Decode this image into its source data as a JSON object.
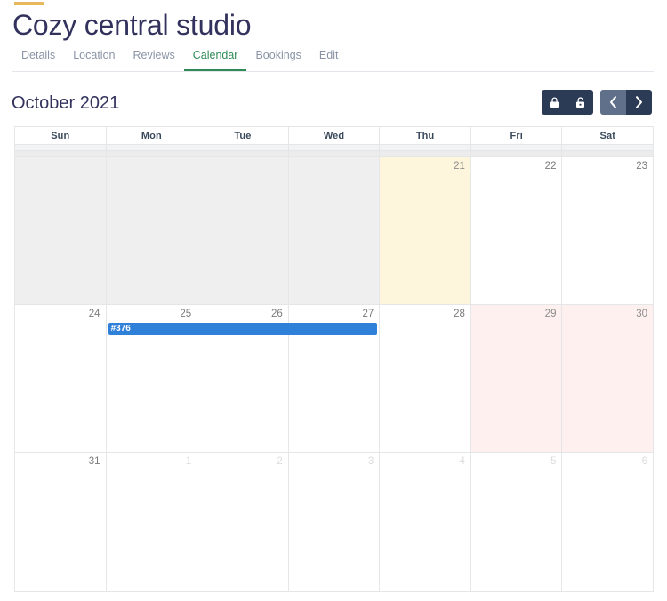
{
  "header": {
    "accent_color": "#e8b85c",
    "title": "Cozy central studio"
  },
  "tabs": [
    {
      "label": "Details",
      "active": false
    },
    {
      "label": "Location",
      "active": false
    },
    {
      "label": "Reviews",
      "active": false
    },
    {
      "label": "Calendar",
      "active": true
    },
    {
      "label": "Bookings",
      "active": false
    },
    {
      "label": "Edit",
      "active": false
    }
  ],
  "calendar": {
    "month_label": "October 2021",
    "accent_active_tab_color": "#2e8b57",
    "controls": {
      "lock_button": {
        "icon": "lock-closed-icon",
        "label": "Lock"
      },
      "unlock_button": {
        "icon": "lock-open-icon",
        "label": "Unlock"
      },
      "prev_button": {
        "icon": "chevron-left-icon",
        "label": "Previous month"
      },
      "next_button": {
        "icon": "chevron-right-icon",
        "label": "Next month"
      }
    },
    "weekday_headers": [
      "Sun",
      "Mon",
      "Tue",
      "Wed",
      "Thu",
      "Fri",
      "Sat"
    ],
    "weeks": [
      [
        {
          "num": "",
          "state": "past"
        },
        {
          "num": "",
          "state": "past"
        },
        {
          "num": "",
          "state": "past"
        },
        {
          "num": "",
          "state": "past"
        },
        {
          "num": "21",
          "state": "today"
        },
        {
          "num": "22",
          "state": "current"
        },
        {
          "num": "23",
          "state": "current"
        }
      ],
      [
        {
          "num": "24",
          "state": "current"
        },
        {
          "num": "25",
          "state": "current"
        },
        {
          "num": "26",
          "state": "current"
        },
        {
          "num": "27",
          "state": "current"
        },
        {
          "num": "28",
          "state": "current"
        },
        {
          "num": "29",
          "state": "blocked"
        },
        {
          "num": "30",
          "state": "blocked"
        }
      ],
      [
        {
          "num": "31",
          "state": "current"
        },
        {
          "num": "1",
          "state": "other"
        },
        {
          "num": "2",
          "state": "other"
        },
        {
          "num": "3",
          "state": "other"
        },
        {
          "num": "4",
          "state": "other"
        },
        {
          "num": "5",
          "state": "other"
        },
        {
          "num": "6",
          "state": "other"
        }
      ]
    ],
    "events": [
      {
        "label": "#376",
        "color": "#2f80d8",
        "week_index": 1,
        "start_col": 1,
        "span_cols": 3
      }
    ],
    "colors": {
      "today_bg": "#fdf6dd",
      "blocked_bg": "#fdf0ef",
      "past_bg": "#efefef",
      "grid_line": "#e4e6e8"
    }
  }
}
